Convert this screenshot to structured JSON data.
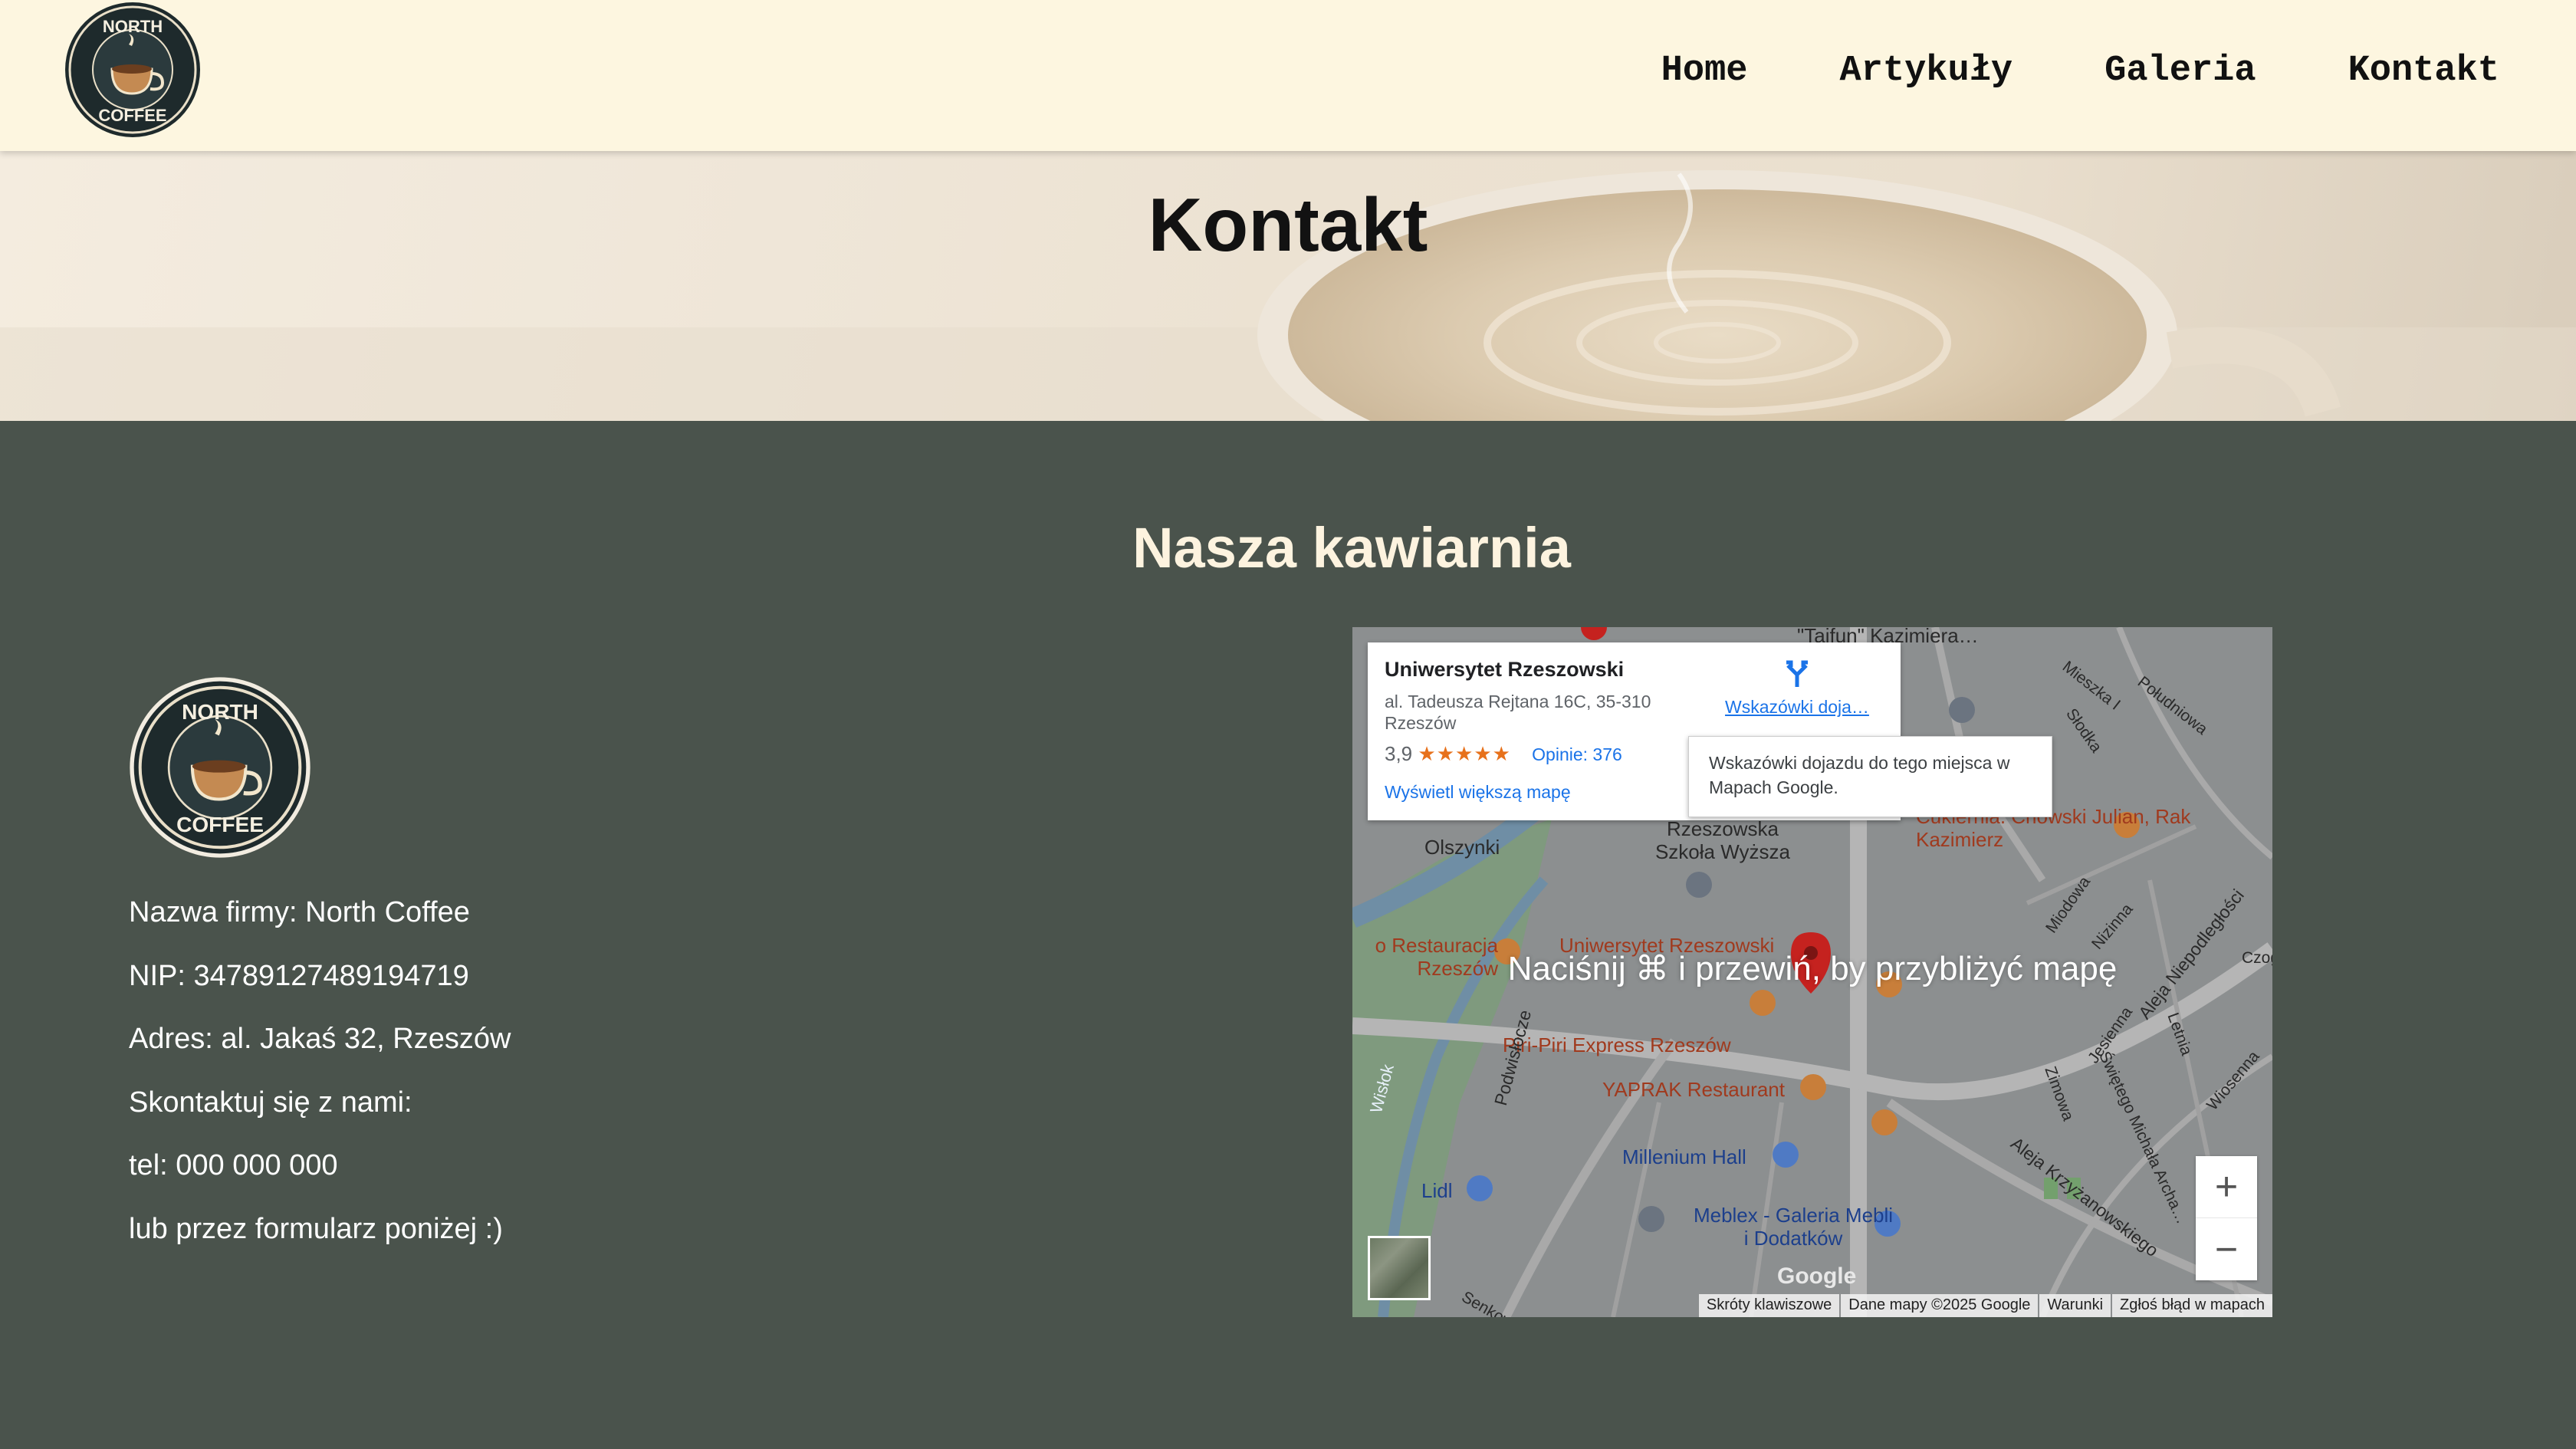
{
  "brand": {
    "logo_top": "NORTH",
    "logo_bottom": "COFFEE"
  },
  "nav": {
    "items": [
      {
        "label": "Home"
      },
      {
        "label": "Artykuły"
      },
      {
        "label": "Galeria"
      },
      {
        "label": "Kontakt"
      }
    ]
  },
  "hero": {
    "title": "Kontakt"
  },
  "section": {
    "title": "Nasza kawiarnia",
    "info": [
      "Nazwa firmy: North Coffee",
      "NIP: 34789127489194719",
      "Adres: al. Jakaś 32, Rzeszów",
      "Skontaktuj się z nami:",
      "tel: 000 000 000",
      "lub przez formularz poniżej :)"
    ]
  },
  "map": {
    "overlay_hint": "Naciśnij ⌘ i przewiń, by przybliżyć mapę",
    "place": {
      "name": "Uniwersytet Rzeszowski",
      "address": "al. Tadeusza Rejtana 16C, 35-310 Rzeszów",
      "rating": "3,9",
      "stars": "★★★★★",
      "reviews": "Opinie: 376",
      "larger_map": "Wyświetl większą mapę",
      "directions": "Wskazówki doja…"
    },
    "tooltip": "Wskazówki dojazdu do tego miejsca w Mapach Google.",
    "labels": [
      "Olszynki",
      "Rzeszowska Szkoła Wyższa",
      "Cukiernia. Chowski Julian, Rak Kazimierz",
      "Uniwersytet Rzeszowski",
      "Piri-Piri Express Rzeszów",
      "o Restauracja Rzeszów",
      "YAPRAK Restaurant",
      "Millenium Hall",
      "Lidl",
      "Meblex - Galeria Mebli i Dodatków",
      "Podwisłocze",
      "Wisłok",
      "Aleja Niepodległości",
      "Aleja Krzyżanowskiego",
      "\"Taifun\" Kazimiera…",
      "Mieszka I",
      "Południowa",
      "Słodka",
      "Miodowa",
      "Jesienna",
      "Letnia",
      "Wiosenna",
      "Zimowa",
      "Świętego Michała Archa…",
      "Nizinna",
      "Czogi",
      "Senkowo"
    ],
    "zoom_in": "+",
    "zoom_out": "−",
    "google": "Google",
    "attribution": [
      "Skróty klawiszowe",
      "Dane mapy ©2025 Google",
      "Warunki",
      "Zgłoś błąd w mapach"
    ]
  }
}
